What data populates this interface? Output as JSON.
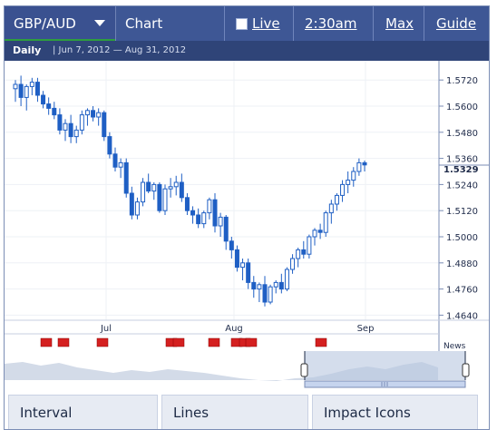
{
  "header": {
    "pair_label": "GBP/AUD",
    "tabs": [
      "Chart",
      "Live",
      "2:30am",
      "Max",
      "Guide"
    ],
    "live_checked": false
  },
  "subheader": {
    "interval": "Daily",
    "range": "| Jun 7, 2012 — Aug 31, 2012"
  },
  "chart_data": {
    "type": "candlestick",
    "y_ticks": [
      "1.5720",
      "1.5600",
      "1.5480",
      "1.5360",
      "1.5240",
      "1.5120",
      "1.5000",
      "1.4880",
      "1.4760",
      "1.4640"
    ],
    "ylim": [
      1.46,
      1.58
    ],
    "x_ticks": [
      "Jul",
      "Aug",
      "Sep"
    ],
    "current_price": "1.5329",
    "news_label": "News",
    "colors": {
      "up": "#ffffff",
      "down": "#1f5fc4",
      "outline": "#1f5fc4"
    },
    "candles": [
      [
        1.568,
        1.572,
        1.562,
        1.57
      ],
      [
        1.57,
        1.574,
        1.56,
        1.564
      ],
      [
        1.564,
        1.57,
        1.558,
        1.569
      ],
      [
        1.569,
        1.573,
        1.565,
        1.571
      ],
      [
        1.571,
        1.573,
        1.562,
        1.565
      ],
      [
        1.565,
        1.567,
        1.559,
        1.561
      ],
      [
        1.561,
        1.564,
        1.556,
        1.559
      ],
      [
        1.559,
        1.562,
        1.554,
        1.556
      ],
      [
        1.556,
        1.559,
        1.547,
        1.549
      ],
      [
        1.549,
        1.554,
        1.544,
        1.552
      ],
      [
        1.552,
        1.556,
        1.543,
        1.546
      ],
      [
        1.546,
        1.551,
        1.543,
        1.549
      ],
      [
        1.549,
        1.558,
        1.547,
        1.556
      ],
      [
        1.556,
        1.559,
        1.551,
        1.558
      ],
      [
        1.558,
        1.56,
        1.553,
        1.555
      ],
      [
        1.555,
        1.559,
        1.551,
        1.557
      ],
      [
        1.557,
        1.558,
        1.544,
        1.546
      ],
      [
        1.546,
        1.548,
        1.536,
        1.538
      ],
      [
        1.538,
        1.541,
        1.53,
        1.532
      ],
      [
        1.532,
        1.536,
        1.527,
        1.534
      ],
      [
        1.534,
        1.536,
        1.518,
        1.52
      ],
      [
        1.52,
        1.523,
        1.508,
        1.51
      ],
      [
        1.51,
        1.518,
        1.508,
        1.516
      ],
      [
        1.516,
        1.527,
        1.514,
        1.525
      ],
      [
        1.525,
        1.529,
        1.52,
        1.521
      ],
      [
        1.521,
        1.525,
        1.517,
        1.524
      ],
      [
        1.524,
        1.525,
        1.511,
        1.512
      ],
      [
        1.512,
        1.524,
        1.51,
        1.522
      ],
      [
        1.522,
        1.527,
        1.518,
        1.523
      ],
      [
        1.523,
        1.528,
        1.519,
        1.525
      ],
      [
        1.525,
        1.529,
        1.516,
        1.518
      ],
      [
        1.518,
        1.52,
        1.51,
        1.512
      ],
      [
        1.512,
        1.514,
        1.506,
        1.51
      ],
      [
        1.51,
        1.513,
        1.504,
        1.506
      ],
      [
        1.506,
        1.512,
        1.504,
        1.511
      ],
      [
        1.511,
        1.518,
        1.508,
        1.517
      ],
      [
        1.517,
        1.52,
        1.502,
        1.505
      ],
      [
        1.505,
        1.511,
        1.5,
        1.509
      ],
      [
        1.509,
        1.51,
        1.494,
        1.498
      ],
      [
        1.498,
        1.5,
        1.49,
        1.494
      ],
      [
        1.494,
        1.496,
        1.484,
        1.486
      ],
      [
        1.486,
        1.49,
        1.48,
        1.488
      ],
      [
        1.488,
        1.49,
        1.476,
        1.479
      ],
      [
        1.479,
        1.482,
        1.472,
        1.476
      ],
      [
        1.476,
        1.479,
        1.47,
        1.478
      ],
      [
        1.478,
        1.482,
        1.468,
        1.47
      ],
      [
        1.47,
        1.478,
        1.469,
        1.477
      ],
      [
        1.477,
        1.48,
        1.474,
        1.479
      ],
      [
        1.479,
        1.483,
        1.474,
        1.476
      ],
      [
        1.476,
        1.486,
        1.475,
        1.485
      ],
      [
        1.485,
        1.492,
        1.483,
        1.49
      ],
      [
        1.49,
        1.495,
        1.486,
        1.494
      ],
      [
        1.494,
        1.498,
        1.49,
        1.492
      ],
      [
        1.492,
        1.501,
        1.49,
        1.5
      ],
      [
        1.5,
        1.504,
        1.496,
        1.503
      ],
      [
        1.503,
        1.506,
        1.499,
        1.502
      ],
      [
        1.502,
        1.512,
        1.5,
        1.511
      ],
      [
        1.511,
        1.517,
        1.506,
        1.515
      ],
      [
        1.515,
        1.52,
        1.512,
        1.519
      ],
      [
        1.519,
        1.526,
        1.516,
        1.524
      ],
      [
        1.524,
        1.53,
        1.52,
        1.526
      ],
      [
        1.526,
        1.532,
        1.523,
        1.53
      ],
      [
        1.53,
        1.536,
        1.528,
        1.534
      ],
      [
        1.534,
        1.535,
        1.53,
        1.533
      ]
    ]
  },
  "news_flags": [
    "news-flag",
    "news-flag",
    "news-flag",
    "news-flag",
    "news-flag",
    "news-flag",
    "news-flag",
    "news-flag"
  ],
  "bottom_tabs": [
    "Interval",
    "Lines",
    "Impact Icons"
  ]
}
